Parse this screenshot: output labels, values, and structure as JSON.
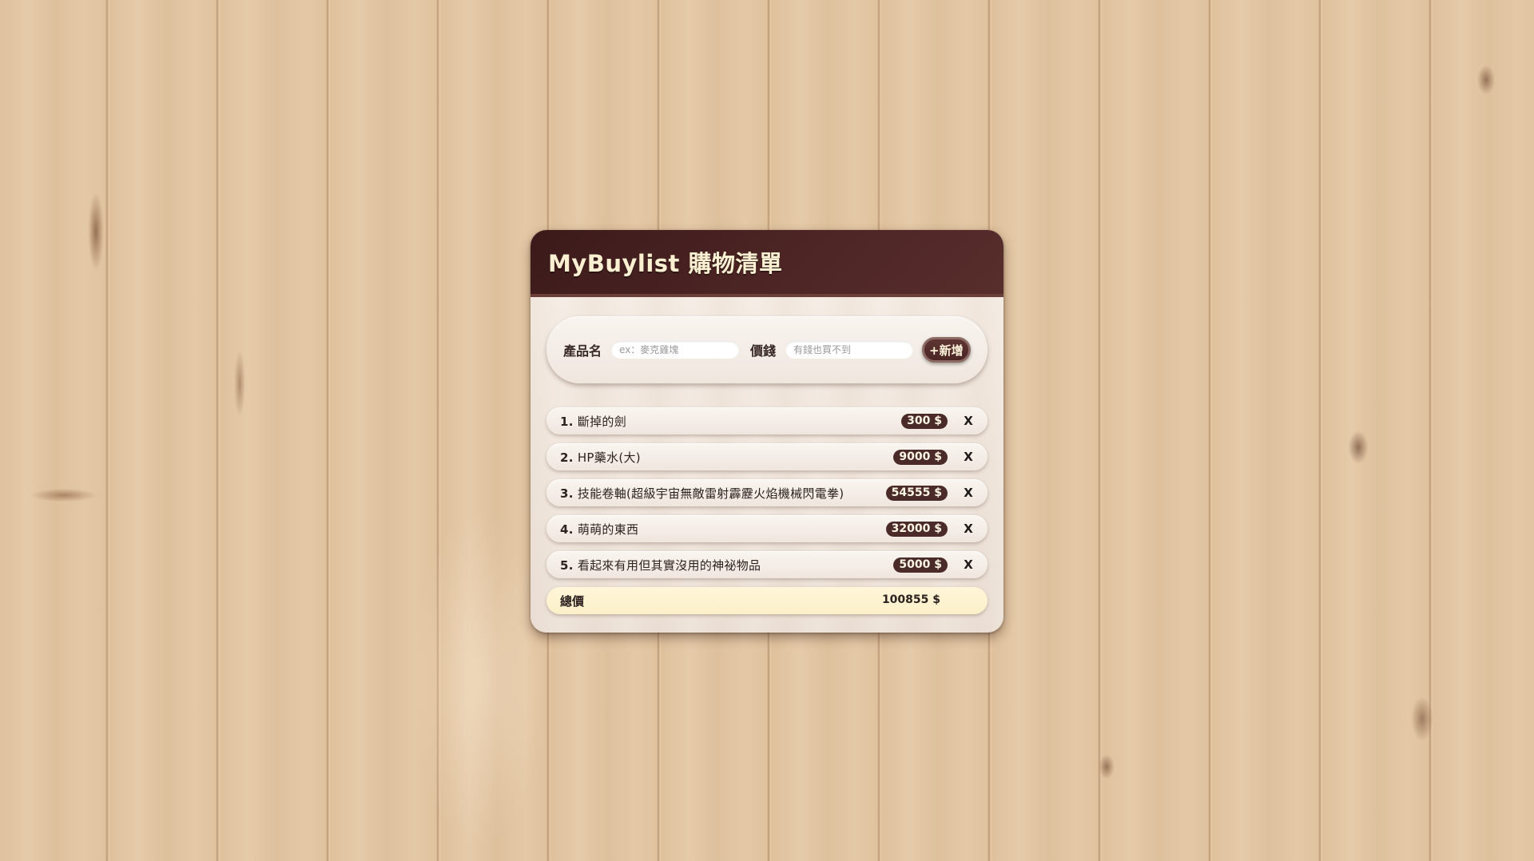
{
  "app": {
    "title": "MyBuylist 購物清單"
  },
  "form": {
    "name_label": "產品名",
    "name_placeholder": "ex：麥克雞塊",
    "price_label": "價錢",
    "price_placeholder": "有錢也買不到",
    "add_button_label": "+新增"
  },
  "items": [
    {
      "index": "1.",
      "name": "斷掉的劍",
      "price": "300 $",
      "delete_label": "X"
    },
    {
      "index": "2.",
      "name": "HP藥水(大)",
      "price": "9000 $",
      "delete_label": "X"
    },
    {
      "index": "3.",
      "name": "技能卷軸(超級宇宙無敵雷射霹靂火焰機械閃電拳)",
      "price": "54555 $",
      "delete_label": "X"
    },
    {
      "index": "4.",
      "name": "萌萌的東西",
      "price": "32000 $",
      "delete_label": "X"
    },
    {
      "index": "5.",
      "name": "看起來有用但其實沒用的神祕物品",
      "price": "5000 $",
      "delete_label": "X"
    }
  ],
  "total": {
    "label": "總價",
    "value": "100855 $"
  },
  "colors": {
    "header": "#4d2525",
    "badge": "#4a2b29",
    "total_bg": "#fbf0c8",
    "title_text": "#fbf1d2"
  }
}
